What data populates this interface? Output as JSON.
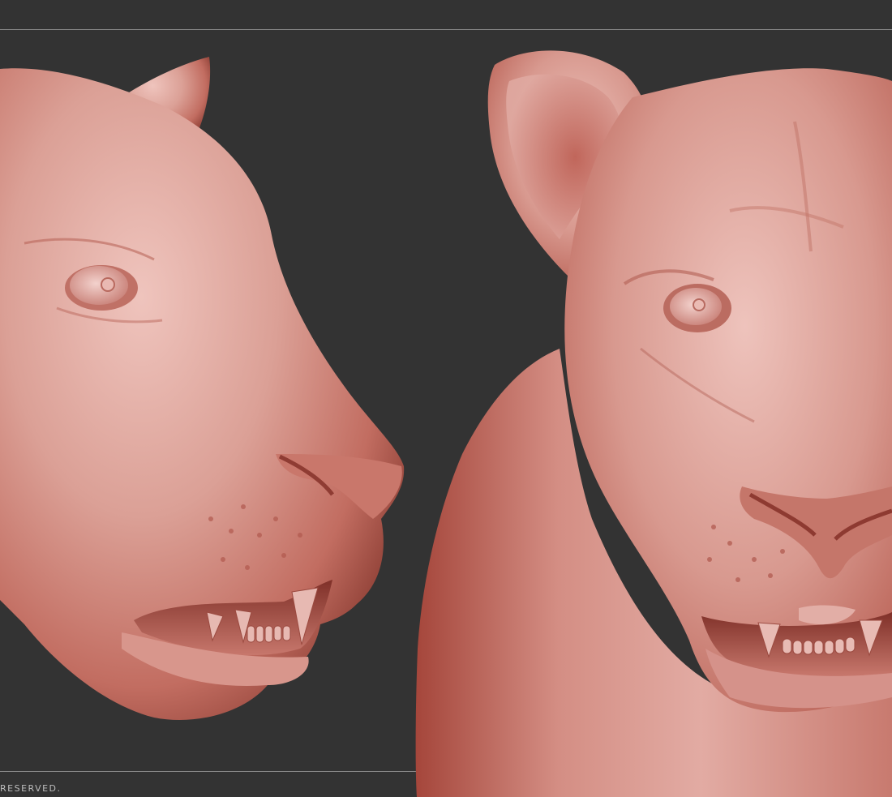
{
  "footer": {
    "text": "RESERVED."
  },
  "colors": {
    "background": "#333333",
    "frame_line": "#8a8a8a",
    "clay_light": "#e8b7b0",
    "clay_mid": "#c9786c",
    "clay_dark": "#8e3f35",
    "footer_text": "#bdbdbd"
  }
}
